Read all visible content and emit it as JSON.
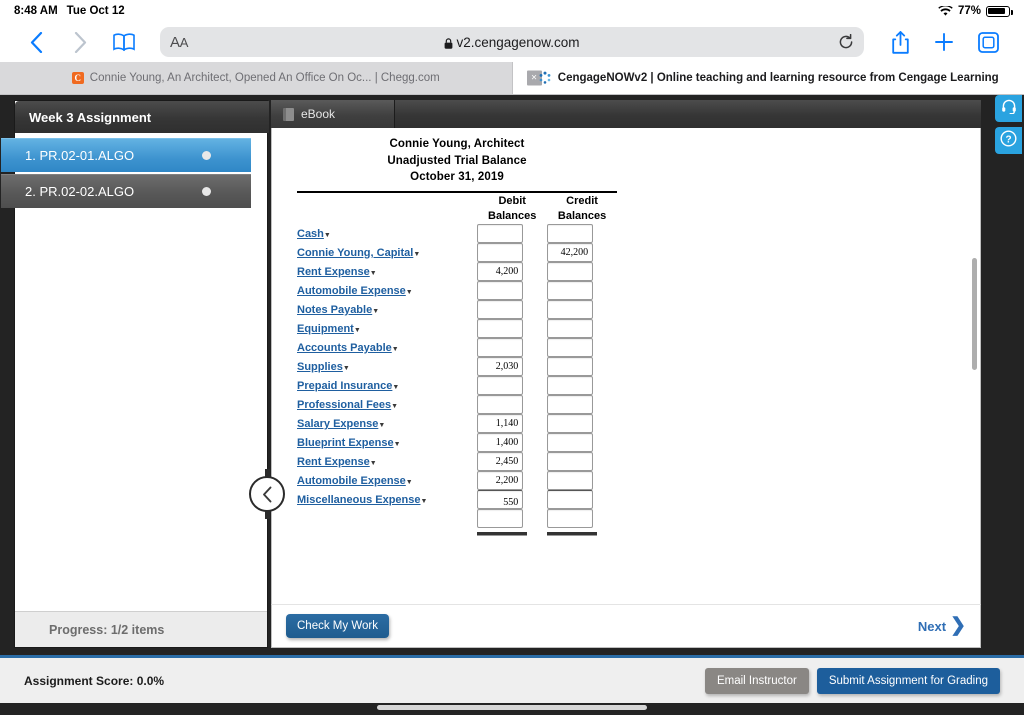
{
  "status_bar": {
    "time": "8:48 AM",
    "date": "Tue Oct 12",
    "battery_percent": "77%",
    "wifi_icon": "wifi-icon",
    "battery_icon": "battery-icon"
  },
  "browser": {
    "back_icon": "chevron-left-icon",
    "forward_icon": "chevron-right-icon",
    "bookmarks_icon": "book-icon",
    "aa_label": "AA",
    "lock_icon": "lock-icon",
    "url": "v2.cengagenow.com",
    "reload_icon": "reload-icon",
    "share_icon": "share-icon",
    "new_tab_icon": "plus-icon",
    "tabs_overview_icon": "tabs-icon",
    "tabs": [
      {
        "title": "Connie Young, An Architect, Opened An Office On Oc... | Chegg.com",
        "favicon": "chegg-favicon",
        "favicon_letter": "C",
        "active": false
      },
      {
        "title": "CengageNOWv2 | Online teaching and learning resource from Cengage Learning",
        "favicon": "cengage-favicon",
        "active": true,
        "close_label": "×"
      }
    ]
  },
  "nav_panel": {
    "title": "Week 3 Assignment",
    "items": [
      {
        "label": "1. PR.02-01.ALGO",
        "state": "active",
        "dot": "status-dot"
      },
      {
        "label": "2. PR.02-02.ALGO",
        "state": "idle",
        "dot": "status-dot"
      }
    ],
    "progress": "Progress:  1/2 items",
    "collapse_icon": "chevron-left-icon"
  },
  "content": {
    "tabs": [
      {
        "label": "eBook",
        "icon": "book-icon"
      }
    ],
    "sheet": {
      "company": "Connie Young, Architect",
      "statement": "Unadjusted Trial Balance",
      "date": "October 31, 2019",
      "columns": [
        "",
        "Debit\nBalances",
        "Credit\nBalances"
      ],
      "col_debit_l1": "Debit",
      "col_debit_l2": "Balances",
      "col_credit_l1": "Credit",
      "col_credit_l2": "Balances",
      "rows": [
        {
          "account": "Cash",
          "debit": "",
          "credit": ""
        },
        {
          "account": "Connie Young, Capital",
          "debit": "",
          "credit": "42,200"
        },
        {
          "account": "Rent Expense",
          "debit": "4,200",
          "credit": ""
        },
        {
          "account": "Automobile Expense",
          "debit": "",
          "credit": ""
        },
        {
          "account": "Notes Payable",
          "debit": "",
          "credit": ""
        },
        {
          "account": "Equipment",
          "debit": "",
          "credit": ""
        },
        {
          "account": "Accounts Payable",
          "debit": "",
          "credit": ""
        },
        {
          "account": "Supplies",
          "debit": "2,030",
          "credit": ""
        },
        {
          "account": "Prepaid Insurance",
          "debit": "",
          "credit": ""
        },
        {
          "account": "Professional Fees",
          "debit": "",
          "credit": ""
        },
        {
          "account": "Salary Expense",
          "debit": "1,140",
          "credit": ""
        },
        {
          "account": "Blueprint Expense",
          "debit": "1,400",
          "credit": ""
        },
        {
          "account": "Rent Expense",
          "debit": "2,450",
          "credit": ""
        },
        {
          "account": "Automobile Expense",
          "debit": "2,200",
          "credit": ""
        },
        {
          "account": "Miscellaneous Expense",
          "debit": "550",
          "credit": ""
        }
      ],
      "total_row": {
        "account": "",
        "debit": "",
        "credit": ""
      }
    },
    "footer": {
      "check_my_work": "Check My Work",
      "next": "Next",
      "next_icon": "chevron-right-icon"
    },
    "float_buttons": [
      {
        "icon": "headset-icon",
        "name": "support-button"
      },
      {
        "icon": "question-mark-icon",
        "name": "help-button"
      }
    ]
  },
  "bottom_bar": {
    "assignment_score": "Assignment Score: 0.0%",
    "email_instructor": "Email Instructor",
    "submit_assignment": "Submit Assignment for Grading"
  },
  "colors": {
    "accent_blue": "#2f87c6",
    "submit_blue": "#1d5e9c",
    "email_gray": "#8a8784",
    "frame_dark": "#232323",
    "link_blue": "#1f5fa0"
  }
}
